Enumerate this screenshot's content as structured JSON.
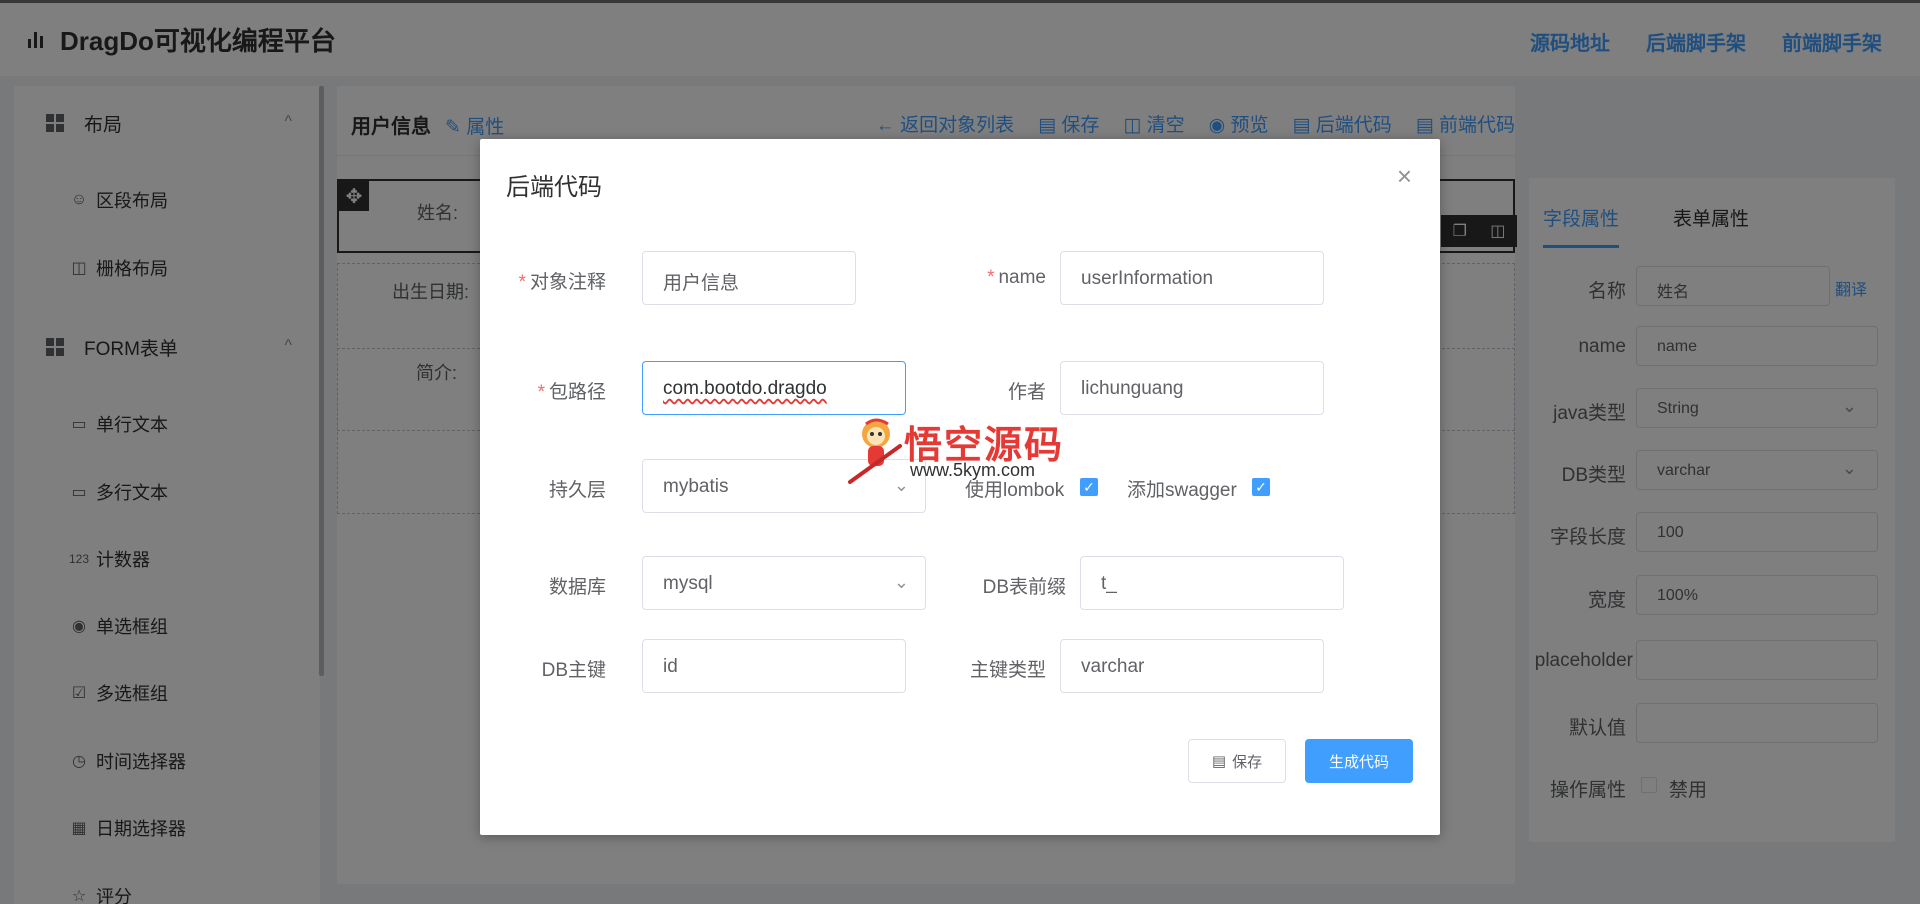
{
  "app": {
    "title": "DragDo可视化编程平台",
    "nav_links": [
      "源码地址",
      "后端脚手架",
      "前端脚手架"
    ]
  },
  "sidebar": {
    "groups": [
      {
        "label": "布局",
        "chevron": "^"
      },
      {
        "label": "FORM表单",
        "chevron": "^"
      }
    ],
    "items": [
      {
        "label": "区段布局",
        "icon": "user-icon"
      },
      {
        "label": "栅格布局",
        "icon": "grid-icon"
      },
      {
        "label": "单行文本",
        "icon": "input-icon"
      },
      {
        "label": "多行文本",
        "icon": "textarea-icon"
      },
      {
        "label": "计数器",
        "icon": "number-icon"
      },
      {
        "label": "单选框组",
        "icon": "radio-icon"
      },
      {
        "label": "多选框组",
        "icon": "checkbox-icon"
      },
      {
        "label": "时间选择器",
        "icon": "clock-icon"
      },
      {
        "label": "日期选择器",
        "icon": "calendar-icon"
      },
      {
        "label": "评分",
        "icon": "star-icon"
      }
    ]
  },
  "designer": {
    "object_title": "用户信息",
    "attr_link": "属性",
    "actions": [
      "← 返回对象列表",
      "保存",
      "清空",
      "预览",
      "后端代码",
      "前端代码"
    ],
    "fields": [
      "姓名:",
      "出生日期:",
      "简介:"
    ]
  },
  "props_panel": {
    "tabs": [
      "字段属性",
      "表单属性"
    ],
    "rows": [
      {
        "label": "名称",
        "value": "姓名"
      },
      {
        "label": "name",
        "value": "name"
      },
      {
        "label": "java类型",
        "value": "String"
      },
      {
        "label": "DB类型",
        "value": "varchar"
      },
      {
        "label": "字段长度",
        "value": "100"
      },
      {
        "label": "宽度",
        "value": "100%"
      },
      {
        "label": "placeholder",
        "value": ""
      },
      {
        "label": "默认值",
        "value": ""
      }
    ],
    "translate_link": "翻译",
    "op_label": "操作属性",
    "disable_label": "禁用"
  },
  "dialog": {
    "title": "后端代码",
    "fields": {
      "obj_comment": {
        "label": "对象注释",
        "value": "用户信息"
      },
      "name": {
        "label": "name",
        "value": "userInformation"
      },
      "package": {
        "label": "包路径",
        "value": "com.bootdo.dragdo"
      },
      "author": {
        "label": "作者",
        "value": "lichunguang"
      },
      "persistence": {
        "label": "持久层",
        "value": "mybatis"
      },
      "lombok": {
        "label": "使用lombok",
        "checked": true
      },
      "swagger": {
        "label": "添加swagger",
        "checked": true
      },
      "database": {
        "label": "数据库",
        "value": "mysql"
      },
      "table_prefix": {
        "label": "DB表前缀",
        "value": "t_"
      },
      "primary_key": {
        "label": "DB主键",
        "value": "id"
      },
      "pk_type": {
        "label": "主键类型",
        "value": "varchar"
      }
    },
    "save_label": "保存",
    "generate_label": "生成代码"
  },
  "watermark": {
    "text": "悟空源码",
    "url": "www.5kym.com"
  },
  "colors": {
    "primary": "#409eff",
    "required": "#f56c6c",
    "watermark": "#e53935"
  }
}
